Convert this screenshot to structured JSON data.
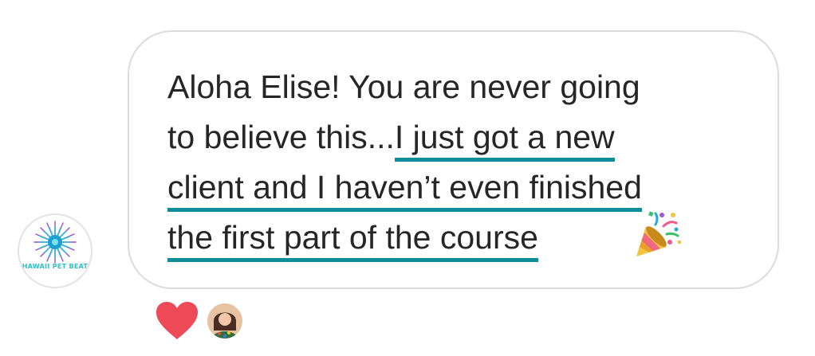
{
  "sender": {
    "avatar_name": "sender-avatar",
    "logo_text": "HAWAII PET BEAT"
  },
  "message": {
    "line1": "Aloha Elise! You are never going",
    "line2_plain": "to believe this...",
    "line2_highlight": "I just got a new",
    "line3_highlight": "client and I haven’t even finished",
    "line4_highlight": "the first part of the course",
    "emoji": "party-popper-icon",
    "highlight_color": "#0f8e99"
  },
  "reactions": {
    "reaction_icon": "heart-icon",
    "heart_color": "#ed4956",
    "reactor_avatar": "reactor-avatar"
  }
}
